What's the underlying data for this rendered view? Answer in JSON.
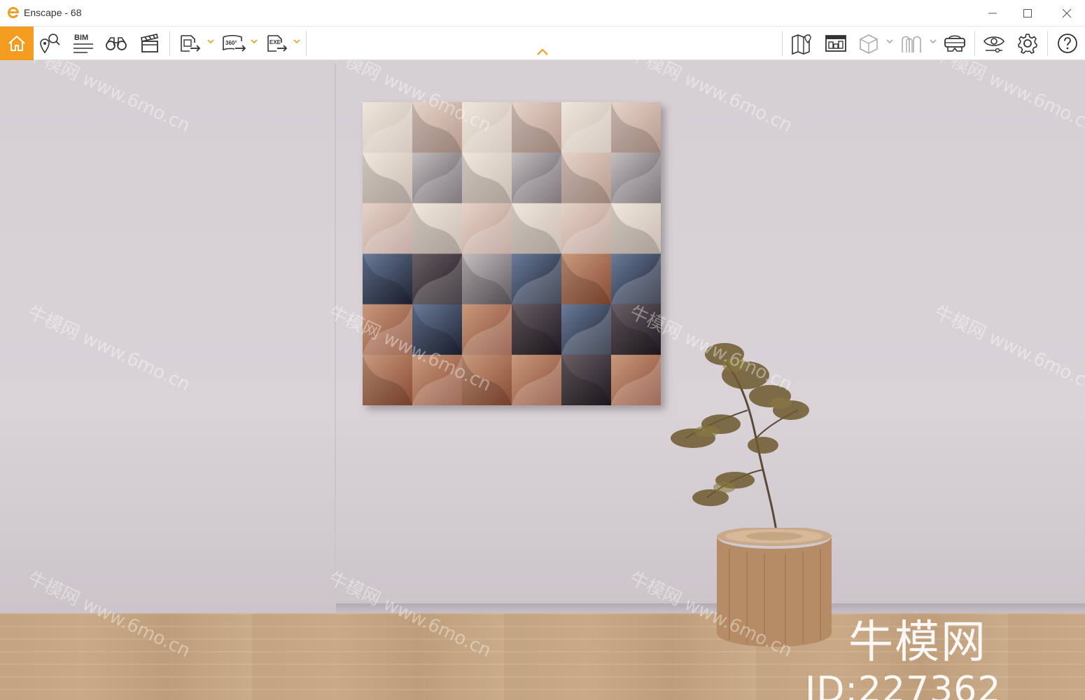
{
  "window": {
    "title": "Enscape - 68",
    "controls": [
      "minimize-icon",
      "maximize-icon",
      "close-icon"
    ]
  },
  "toolbar": {
    "accent_color": "#f39c1f",
    "left_buttons": [
      {
        "name": "home",
        "icon": "home-icon"
      },
      {
        "name": "location",
        "icon": "map-pin-search-icon"
      },
      {
        "name": "bim",
        "icon": "bim-icon",
        "label": "BIM"
      },
      {
        "name": "views",
        "icon": "binoculars-icon"
      },
      {
        "name": "video-editor",
        "icon": "clapperboard-icon"
      },
      {
        "name": "screenshot-export",
        "icon": "image-export-icon"
      },
      {
        "name": "panorama-export",
        "icon": "panorama-export-icon",
        "label": "360°"
      },
      {
        "name": "exe-export",
        "icon": "exe-export-icon",
        "label": "EXE"
      }
    ],
    "right_buttons": [
      {
        "name": "map",
        "icon": "map-icon"
      },
      {
        "name": "asset-library",
        "icon": "asset-library-icon"
      },
      {
        "name": "material-editor",
        "icon": "cube-icon"
      },
      {
        "name": "sun",
        "icon": "arches-icon"
      },
      {
        "name": "vr",
        "icon": "vr-headset-icon"
      },
      {
        "name": "visual-settings",
        "icon": "eye-icon"
      },
      {
        "name": "settings",
        "icon": "gear-icon"
      },
      {
        "name": "help",
        "icon": "help-icon"
      }
    ]
  },
  "viewport": {
    "scene": "render-viewport",
    "watermark": {
      "title": "牛模网",
      "id": "ID:227362",
      "repeat_text": "牛模网 www.6mo.cn"
    }
  }
}
